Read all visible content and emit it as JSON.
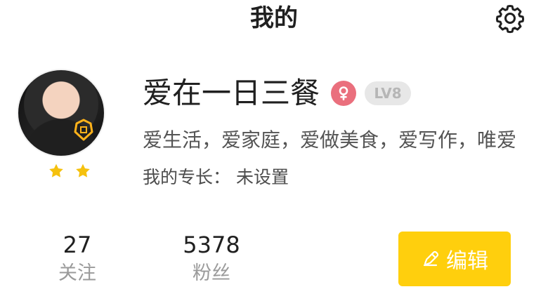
{
  "header": {
    "title": "我的"
  },
  "profile": {
    "username": "爱在一日三餐",
    "level": "LV8",
    "bio": "爱生活，爱家庭，爱做美食，爱写作，唯爱",
    "specialty": "我的专长： 未设置",
    "stars": 2,
    "gender_icon": "female-icon"
  },
  "stats": {
    "following": {
      "value": "27",
      "label": "关注"
    },
    "fans": {
      "value": "5378",
      "label": "粉丝"
    }
  },
  "actions": {
    "edit": "编辑"
  },
  "colors": {
    "accent": "#ffcf0d",
    "gender": "#ea6f7d",
    "star": "#f5c10e",
    "level_bg": "#e7e7e7",
    "level_text": "#b6b6b6"
  }
}
